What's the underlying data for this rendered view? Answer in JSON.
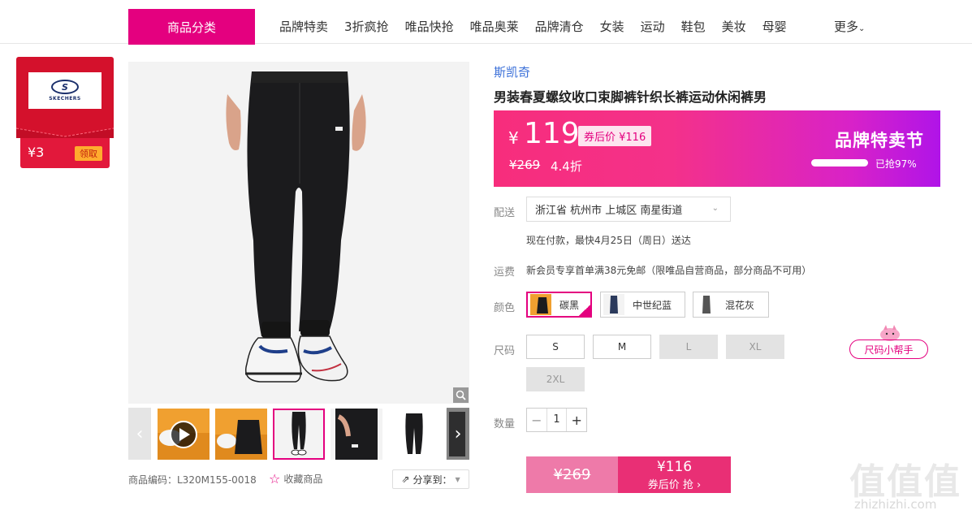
{
  "nav": {
    "category_label": "商品分类",
    "links": [
      "品牌特卖",
      "3折疯抢",
      "唯品快抢",
      "唯品奥莱",
      "品牌清仓",
      "女装",
      "运动",
      "鞋包",
      "美妆",
      "母婴"
    ],
    "more_label": "更多"
  },
  "brand_card": {
    "logo_text": "SKECHERS",
    "coupon_value": "¥3",
    "coupon_action": "领取"
  },
  "gallery": {
    "thumb_count": 6,
    "selected_thumb": 3
  },
  "product_code": "商品编码：L320M155-0018",
  "favorite_label": "收藏商品",
  "share_label": "分享到：",
  "brand": "斯凯奇",
  "title": "男装春夏螺纹收口束脚裤针织长裤运动休闲裤男",
  "price": {
    "currency": "¥",
    "value": "119",
    "coupon_tag": "券后价 ¥116",
    "original": "¥269",
    "discount": "4.4折",
    "event": "品牌特卖节",
    "sold_text": "已抢97%",
    "sold_fraction": 0.97
  },
  "delivery": {
    "label": "配送",
    "address": "浙江省 杭州市 上城区 南星街道",
    "eta": "现在付款，最快4月25日（周日）送达"
  },
  "shipping": {
    "label": "运费",
    "text": "新会员专享首单满38元免邮（限唯品自营商品，部分商品不可用）"
  },
  "color": {
    "label": "颜色",
    "options": [
      {
        "name": "碳黑",
        "selected": true
      },
      {
        "name": "中世纪蓝",
        "selected": false
      },
      {
        "name": "混花灰",
        "selected": false
      }
    ]
  },
  "size": {
    "label": "尺码",
    "options": [
      {
        "name": "S",
        "available": true
      },
      {
        "name": "M",
        "available": true
      },
      {
        "name": "L",
        "available": false
      },
      {
        "name": "XL",
        "available": false
      },
      {
        "name": "2XL",
        "available": false
      }
    ],
    "helper": "尺码小帮手"
  },
  "quantity": {
    "label": "数量",
    "value": "1",
    "minus": "−",
    "plus": "+"
  },
  "buy": {
    "original": "¥269",
    "price": "¥116",
    "action": "券后价 抢 ›"
  },
  "watermark": {
    "text": "值值值",
    "url": "zhizhizhi.com"
  },
  "colors": {
    "accent": "#e4007f",
    "banner_start": "#f72d7c",
    "banner_end": "#b014e8"
  }
}
